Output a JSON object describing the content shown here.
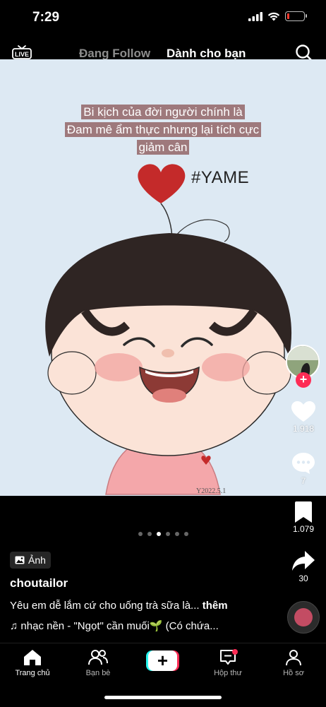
{
  "status_bar": {
    "time": "7:29",
    "battery_level": 0.15,
    "battery_color": "#ff3b30"
  },
  "top_nav": {
    "live_label": "LIVE",
    "following_tab": "Đang Follow",
    "foryou_tab": "Dành cho bạn"
  },
  "post": {
    "caption_overlay": [
      "Bi kịch của đời người chính là",
      "Đam mê ẩm thực nhưng lại tích cực",
      "giảm cân"
    ],
    "hashtag_overlay": "#YAME",
    "media_background": "#dde9f3",
    "slide_count": 6,
    "active_slide": 3,
    "photo_badge": "Ảnh",
    "username": "choutailor",
    "description": "Yêu em dễ lắm cứ cho uống trà sữa là...",
    "more_label": "thêm",
    "music": "nhạc nền - \"Ngọt\" cần muối🌱 (Có chứa..."
  },
  "actions": {
    "likes": "1.918",
    "comments": "7",
    "saves": "1.079",
    "shares": "30"
  },
  "bottom_nav": {
    "home": "Trang chủ",
    "friends": "Bạn bè",
    "inbox": "Hộp thư",
    "profile": "Hồ sơ"
  },
  "colors": {
    "accent": "#fe2c55",
    "accent_alt": "#25f4ee"
  }
}
